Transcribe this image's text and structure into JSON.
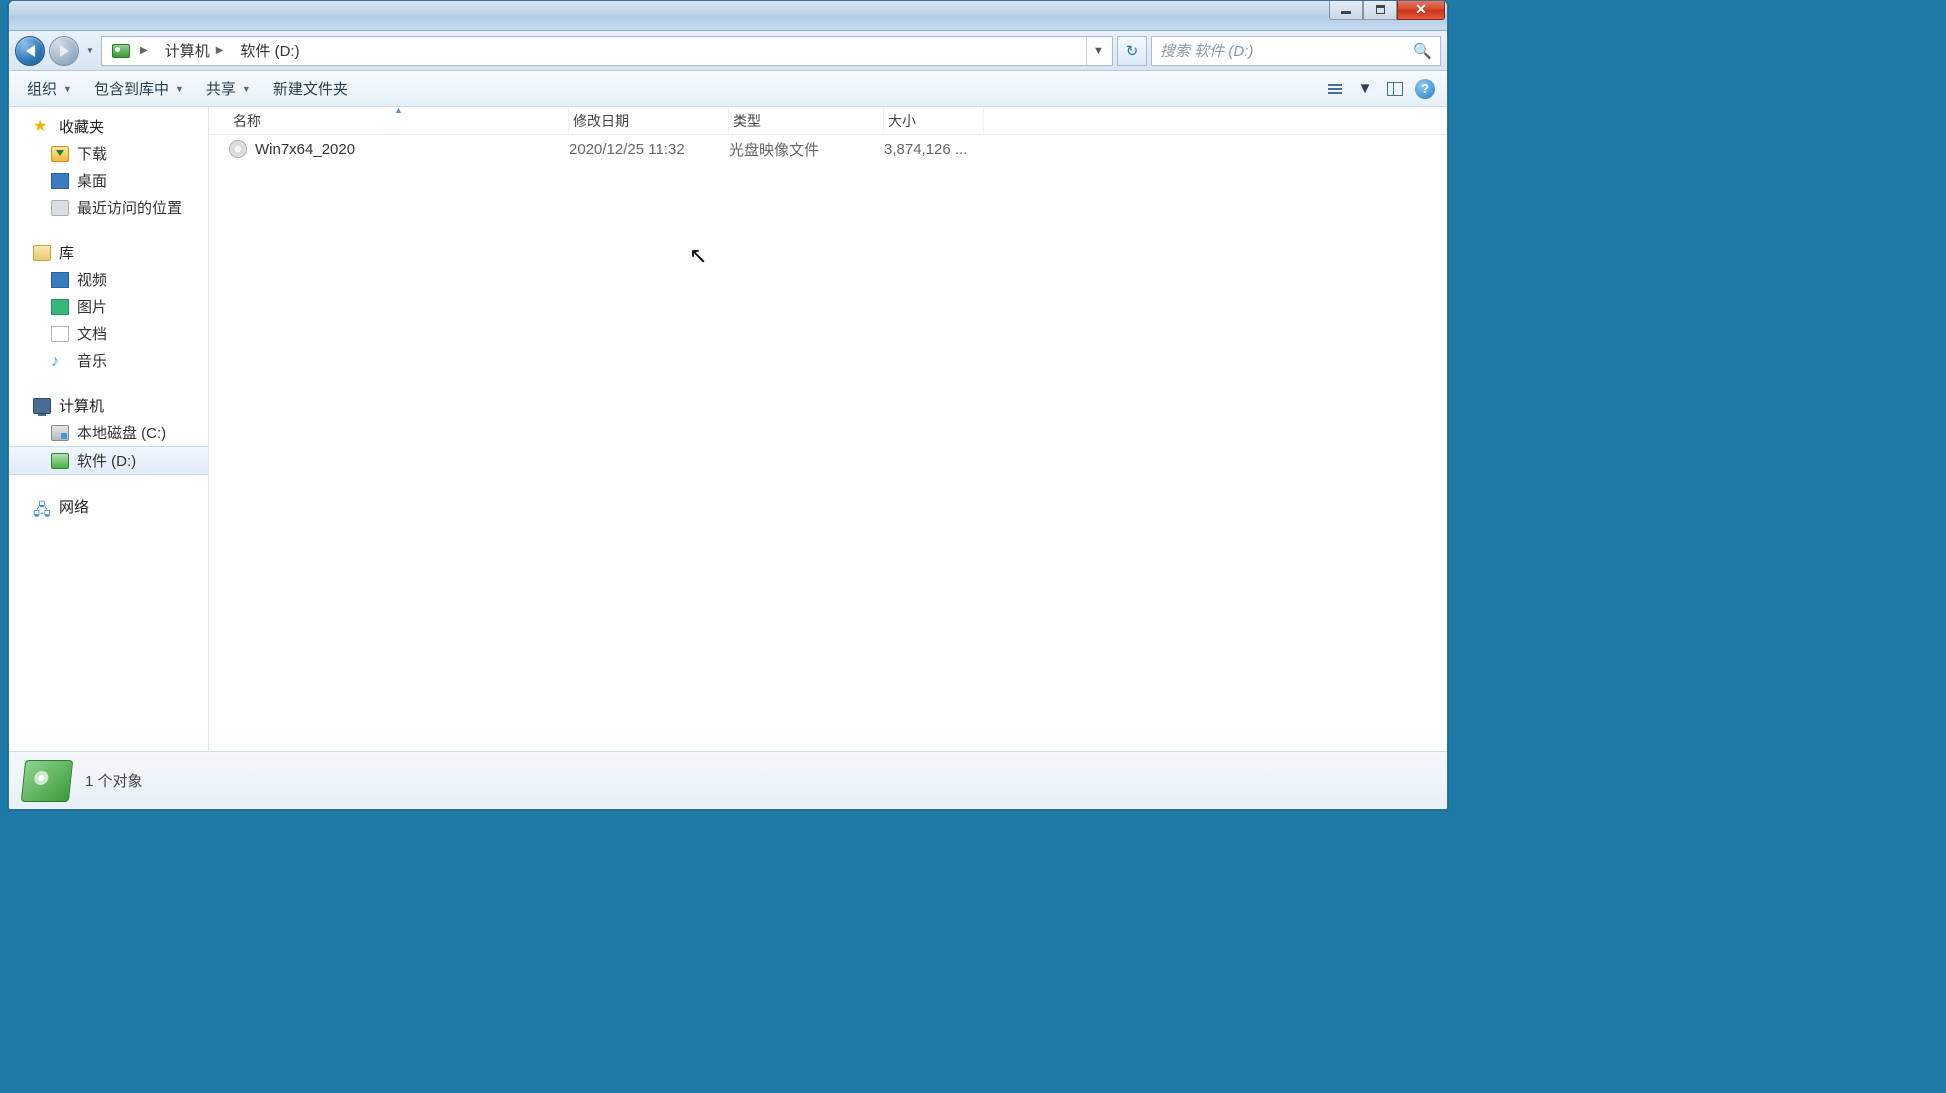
{
  "window": {
    "title": ""
  },
  "address": {
    "segments": [
      "计算机",
      "软件 (D:)"
    ]
  },
  "search": {
    "placeholder": "搜索 软件 (D:)"
  },
  "toolbar": {
    "organize": "组织",
    "include": "包含到库中",
    "share": "共享",
    "newfolder": "新建文件夹"
  },
  "sidebar": {
    "favorites": {
      "label": "收藏夹",
      "items": [
        "下载",
        "桌面",
        "最近访问的位置"
      ]
    },
    "libraries": {
      "label": "库",
      "items": [
        "视频",
        "图片",
        "文档",
        "音乐"
      ]
    },
    "computer": {
      "label": "计算机",
      "items": [
        "本地磁盘 (C:)",
        "软件 (D:)"
      ],
      "selected_index": 1
    },
    "network": {
      "label": "网络"
    }
  },
  "columns": {
    "name": "名称",
    "date": "修改日期",
    "type": "类型",
    "size": "大小"
  },
  "files": [
    {
      "name": "Win7x64_2020",
      "date": "2020/12/25 11:32",
      "type": "光盘映像文件",
      "size": "3,874,126 ..."
    }
  ],
  "status": {
    "text": "1 个对象"
  }
}
